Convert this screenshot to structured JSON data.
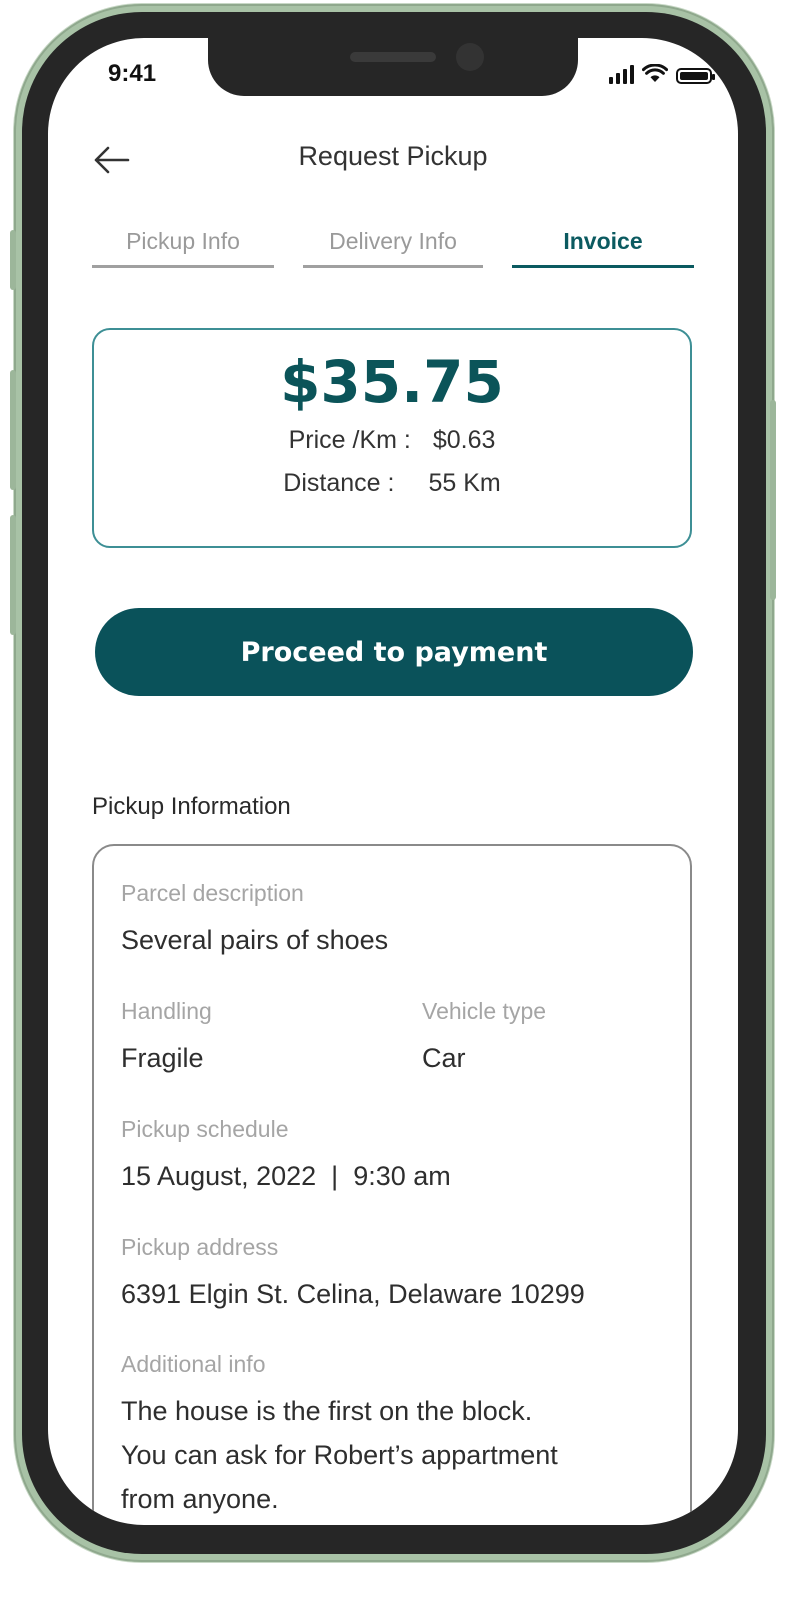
{
  "status_bar": {
    "time": "9:41"
  },
  "header": {
    "title": "Request Pickup",
    "back_icon": "arrow-left-icon"
  },
  "tabs": [
    {
      "label": "Pickup Info",
      "active": false
    },
    {
      "label": "Delivery Info",
      "active": false
    },
    {
      "label": "Invoice",
      "active": true
    }
  ],
  "invoice": {
    "total": "$35.75",
    "price_label": "Price /Km :",
    "price_value": "$0.63",
    "distance_label": "Distance :",
    "distance_value": "55 Km"
  },
  "actions": {
    "pay_label": "Proceed to payment"
  },
  "pickup_info": {
    "section_title": "Pickup Information",
    "parcel_label": "Parcel description",
    "parcel_value": "Several pairs of shoes",
    "handling_label": "Handling",
    "handling_value": "Fragile",
    "vehicle_label": "Vehicle type",
    "vehicle_value": "Car",
    "schedule_label": "Pickup schedule",
    "schedule_value": "15 August, 2022  |  9:30 am",
    "address_label": "Pickup address",
    "address_value": "6391 Elgin St. Celina, Delaware 10299",
    "additional_label": "Additional info",
    "additional_lines": [
      "The house is the first on the block.",
      "You can ask for Robert’s appartment",
      "from anyone."
    ]
  },
  "colors": {
    "accent": "#0a525a",
    "card_border": "#3d8f95",
    "phone_frame": "#a8c2a6"
  }
}
